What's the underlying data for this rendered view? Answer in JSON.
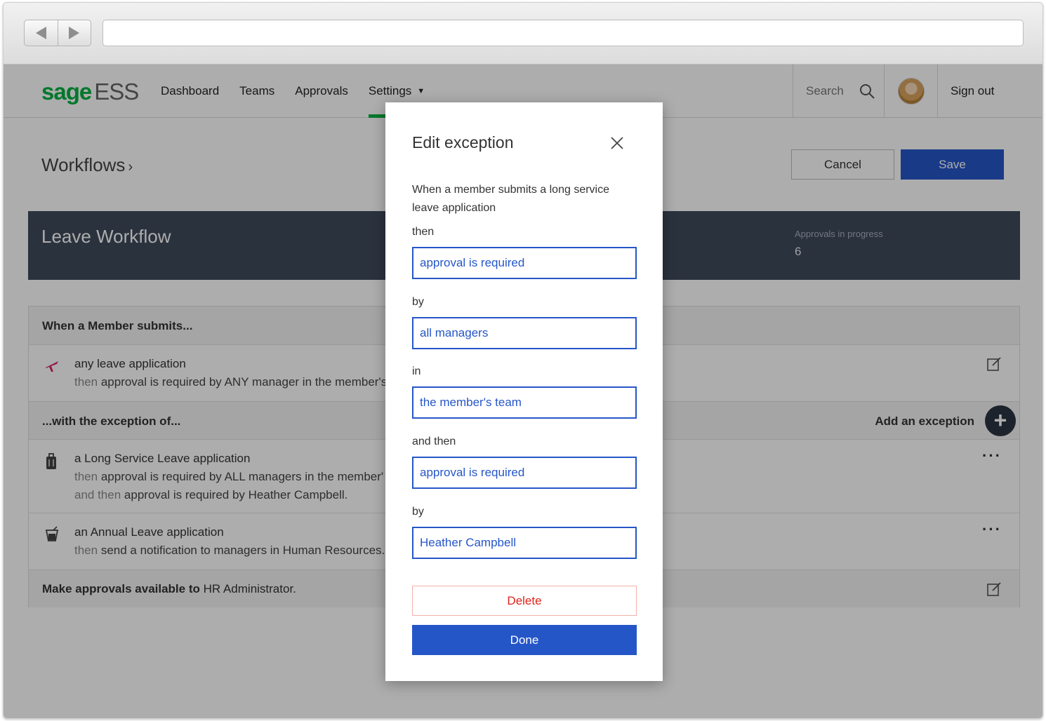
{
  "app": {
    "logo_sage": "sage",
    "logo_ess": "ESS",
    "nav": [
      "Dashboard",
      "Teams",
      "Approvals",
      "Settings"
    ],
    "search_label": "Search",
    "signout": "Sign out"
  },
  "page": {
    "title": "Workflows",
    "chevron": "›",
    "cancel": "Cancel",
    "save": "Save"
  },
  "banner": {
    "title": "Leave Workflow",
    "stat_label": "Approvals in progress",
    "stat_value": "6"
  },
  "workflow": {
    "section_when": "When a Member submits...",
    "rule_title": "any leave application",
    "rule_then": "then",
    "rule_text": "approval is required by ANY manager in the member's",
    "section_exceptions": "...with the exception of...",
    "add_exception": "Add an exception",
    "exc1_title": "a Long Service Leave application",
    "exc1_then": "then",
    "exc1_text": "approval is required by ALL managers in the member'",
    "exc1_andthen": "and then",
    "exc1_text2": "approval is required by Heather Campbell.",
    "exc2_title": "an Annual Leave application",
    "exc2_then": "then",
    "exc2_text": "send a notification to managers in Human Resources.",
    "footer_prefix": "Make approvals available to",
    "footer_value": "HR Administrator."
  },
  "modal": {
    "title": "Edit exception",
    "description": "When a member submits a long service leave application",
    "fields": [
      {
        "label": "then",
        "value": "approval is required"
      },
      {
        "label": "by",
        "value": "all managers"
      },
      {
        "label": "in",
        "value": "the member's team"
      },
      {
        "label": "and then",
        "value": "approval is required"
      },
      {
        "label": "by",
        "value": "Heather Campbell"
      }
    ],
    "delete": "Delete",
    "done": "Done"
  },
  "colors": {
    "brand_green": "#00b140",
    "primary_blue": "#2556c8",
    "banner_dark": "#3f4a5c",
    "danger_red": "#e0231b",
    "plane_pink": "#d6286b"
  },
  "icons": [
    "plane-icon",
    "luggage-icon",
    "cocktail-icon",
    "edit-icon",
    "more-icon",
    "plus-icon",
    "search-icon",
    "close-icon",
    "back-arrow-icon",
    "forward-arrow-icon"
  ]
}
